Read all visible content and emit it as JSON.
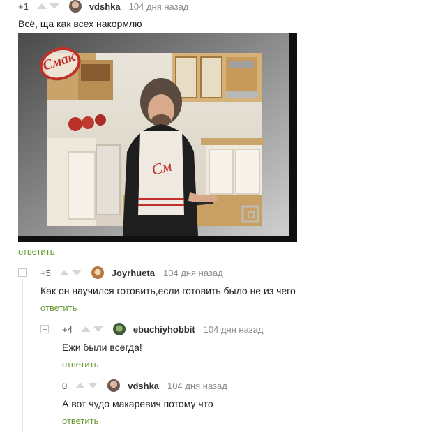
{
  "comments": [
    {
      "rating": "+1",
      "username": "vdshka",
      "date": "104 дня назад",
      "text": "Всё, ща как всех накормлю",
      "reply": "ответить",
      "video": {
        "logo": "Смак"
      }
    },
    {
      "rating": "+5",
      "username": "Joyrhueta",
      "date": "104 дня назад",
      "text": "Как он научился готовить,если готовить было не из чего",
      "reply": "ответить"
    },
    {
      "rating": "+4",
      "username": "ebuchiyhobbit",
      "date": "104 дня назад",
      "text": "Ежи были всегда!",
      "reply": "ответить"
    },
    {
      "rating": "0",
      "username": "vdshka",
      "date": "104 дня назад",
      "text": "А вот чудо макаревич потому что",
      "reply": "ответить"
    }
  ],
  "colors": {
    "reply_link": "#669933",
    "date": "#8c8c8c",
    "vote_arrow": "#d6d6d6"
  }
}
